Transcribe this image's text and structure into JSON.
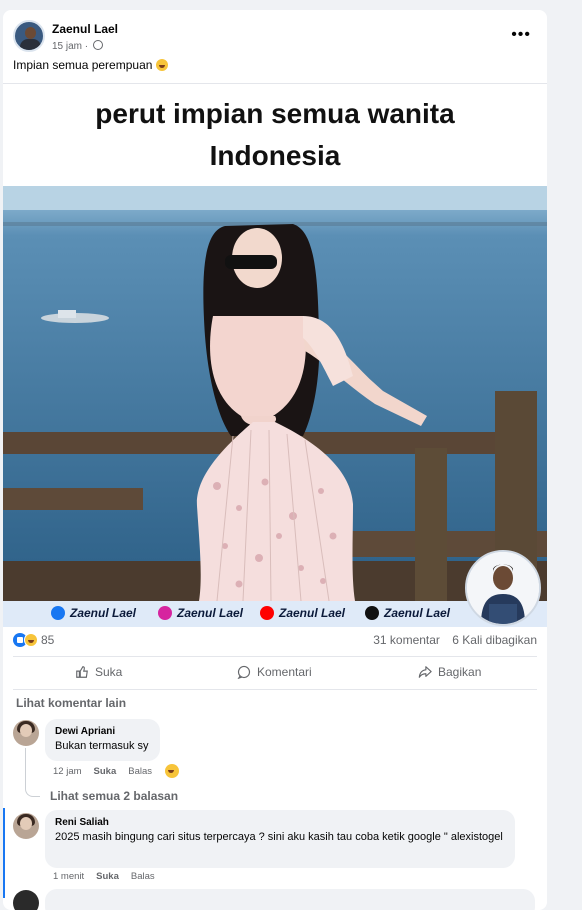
{
  "post": {
    "author": "Zaenul Lael",
    "time": "15 jam ·",
    "caption": "Impian semua perempuan",
    "menu_icon": "•••"
  },
  "image": {
    "headline_line1": "perut impian semua wanita",
    "headline_line2": "Indonesia",
    "socials": [
      {
        "icon": "facebook-icon",
        "label": "Zaenul Lael",
        "color": "#1877f2"
      },
      {
        "icon": "instagram-icon",
        "label": "Zaenul Lael",
        "color": "#d6249f"
      },
      {
        "icon": "youtube-icon",
        "label": "Zaenul Lael",
        "color": "#ff0000"
      },
      {
        "icon": "tiktok-icon",
        "label": "Zaenul Lael",
        "color": "#111111"
      }
    ]
  },
  "stats": {
    "reactions_count": "85",
    "comments": "31 komentar",
    "shares": "6 Kali dibagikan"
  },
  "actions": {
    "like": "Suka",
    "comment": "Komentari",
    "share": "Bagikan"
  },
  "comments": {
    "more_label": "Lihat komentar lain",
    "items": [
      {
        "name": "Dewi Apriani",
        "text": "Bukan termasuk sy",
        "time": "12 jam",
        "like": "Suka",
        "reply": "Balas"
      },
      {
        "name": "Reni Saliah",
        "text": "2025 masih bingung cari situs terpercaya ? sini aku kasih tau coba ketik google \" alexistogel",
        "time": "1 menit",
        "like": "Suka",
        "reply": "Balas"
      }
    ],
    "see_replies": "Lihat semua 2 balasan"
  },
  "colors": {
    "accent": "#1877f2",
    "text_secondary": "#65676b",
    "page_bg": "#f0f2f5"
  }
}
